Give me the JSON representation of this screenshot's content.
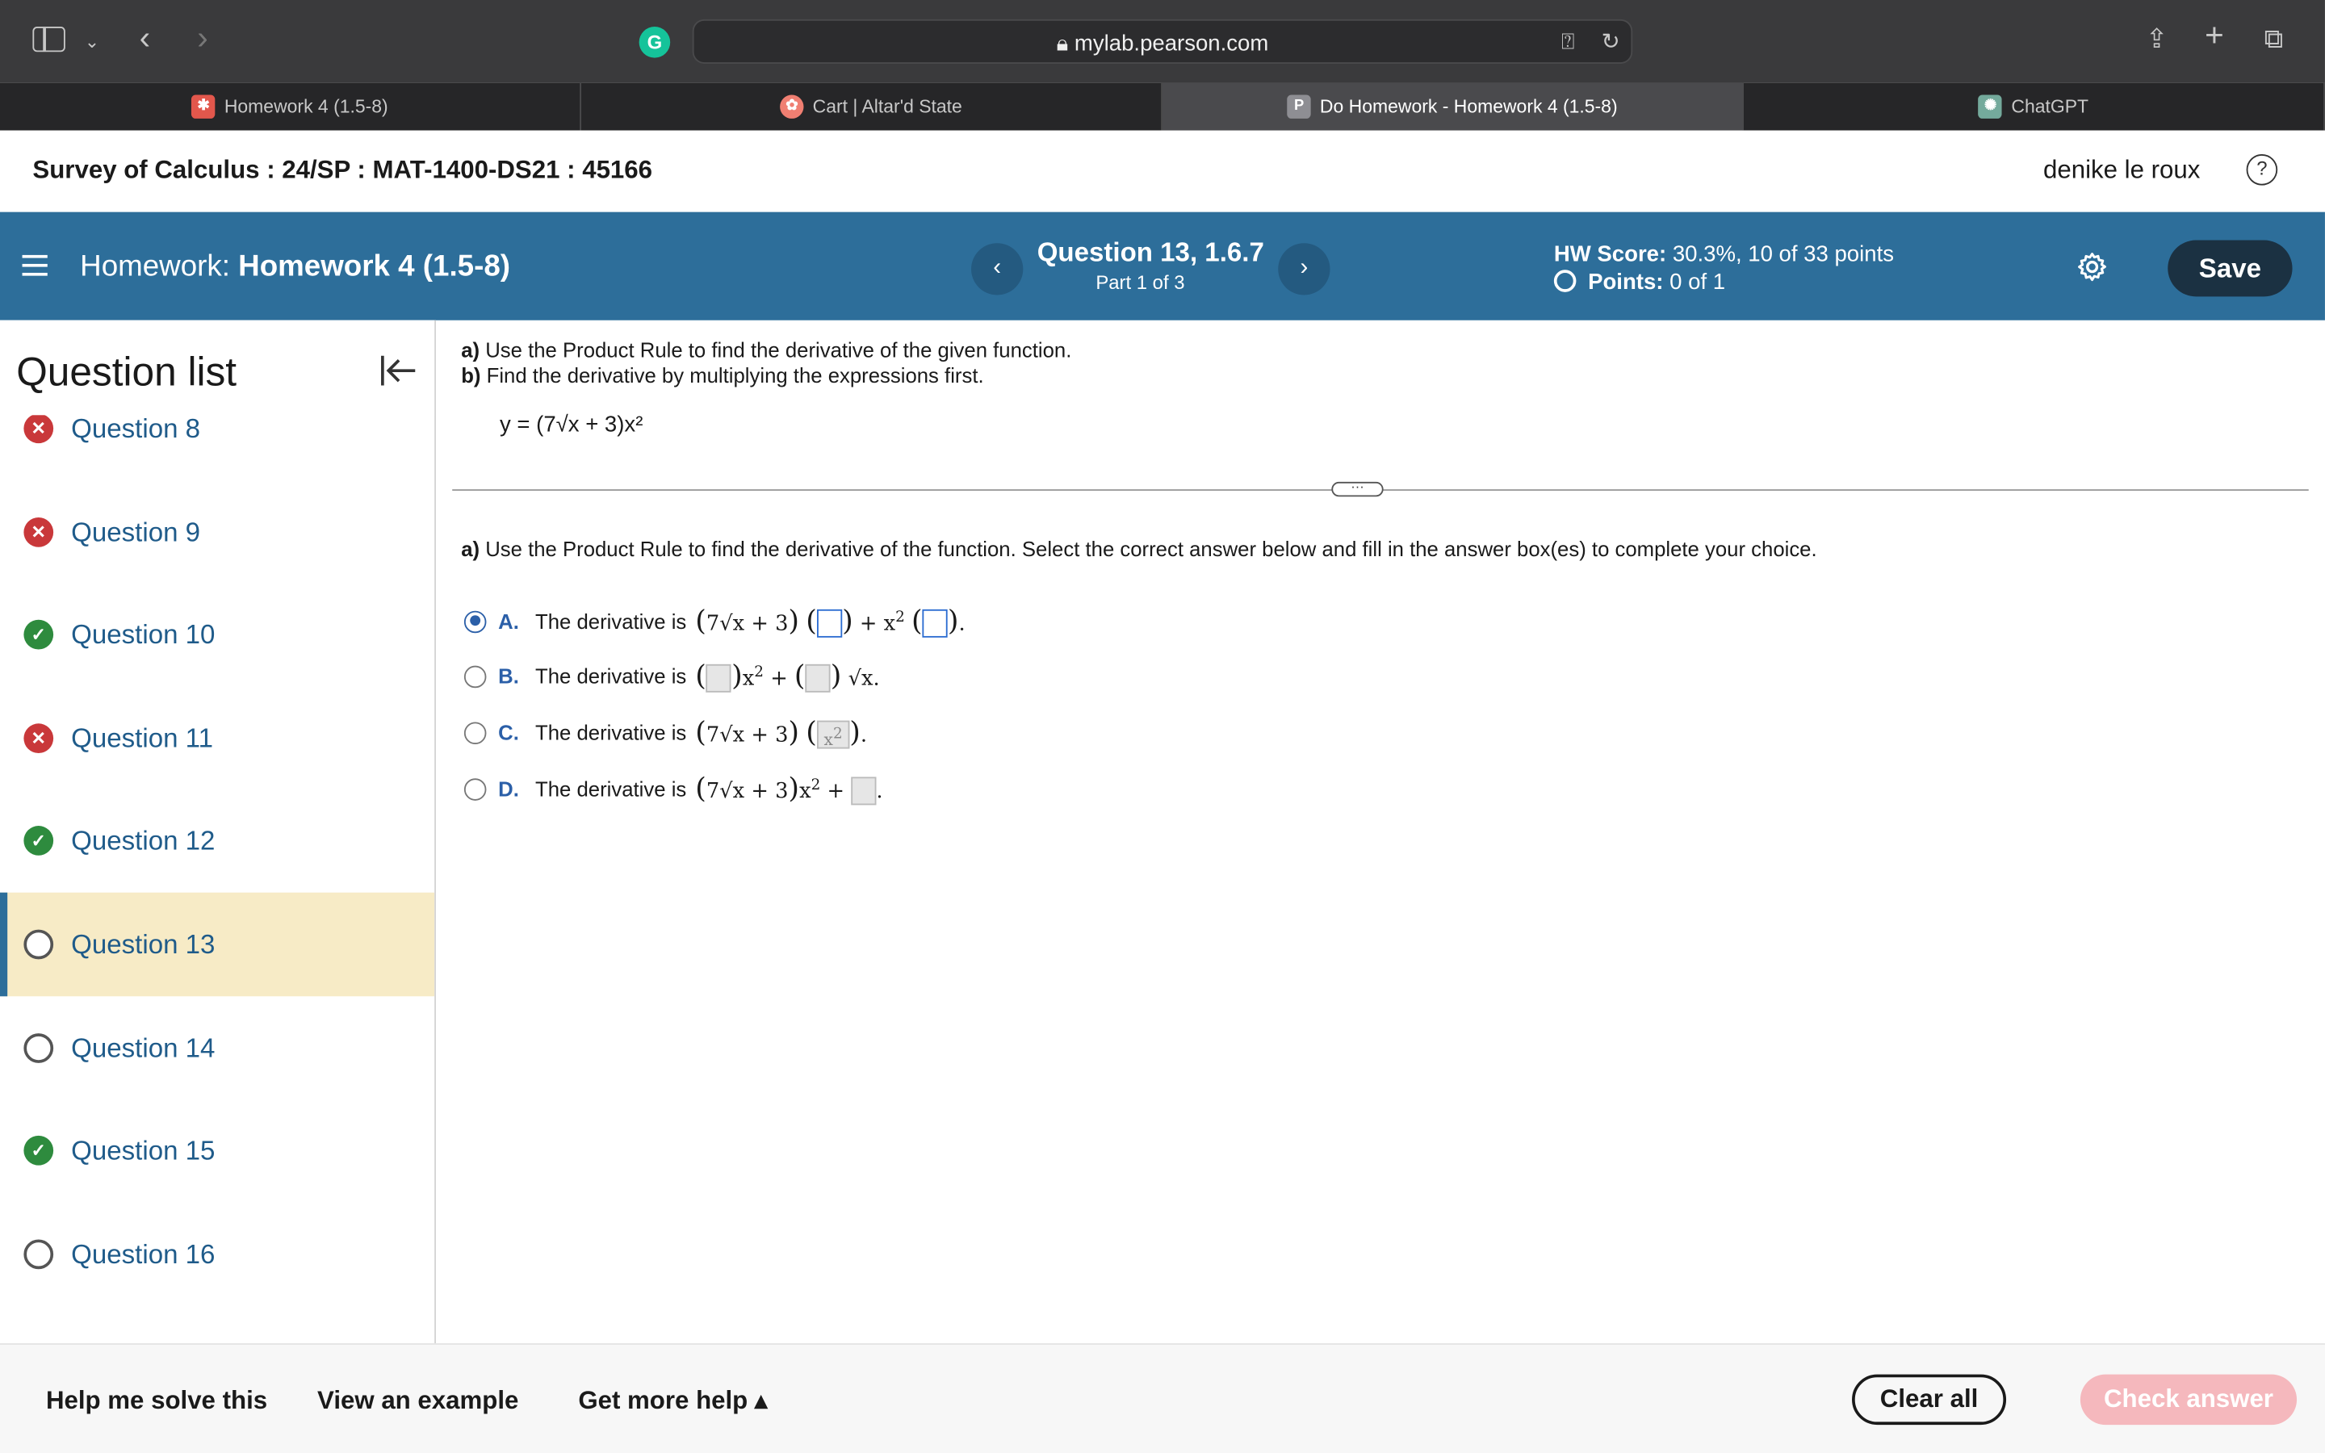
{
  "browser": {
    "url": "mylab.pearson.com",
    "tabs": [
      {
        "label": "Homework 4 (1.5-8)",
        "active": false,
        "favicon_color": "#e2574c"
      },
      {
        "label": "Cart | Altar'd State",
        "active": false,
        "favicon_color": "#f07f72"
      },
      {
        "label": "Do Homework - Homework 4 (1.5-8)",
        "active": true,
        "favicon_color": "#8e8e93"
      },
      {
        "label": "ChatGPT",
        "active": false,
        "favicon_color": "#74aa9c"
      }
    ]
  },
  "course": {
    "title": "Survey of Calculus : 24/SP : MAT-1400-DS21 : 45166",
    "user": "denike le roux",
    "help_icon": "?"
  },
  "homework_bar": {
    "prefix": "Homework:",
    "name": "Homework 4 (1.5-8)",
    "question_title": "Question 13, 1.6.7",
    "part": "Part 1 of 3",
    "score_label": "HW Score:",
    "score_value": "30.3%, 10 of 33 points",
    "points_label": "Points:",
    "points_value": "0 of 1",
    "save_label": "Save",
    "prev_icon": "‹",
    "next_icon": "›",
    "accent_color": "#2d6e9a"
  },
  "question_list": {
    "title": "Question list",
    "items": [
      {
        "label": "Question 8",
        "status": "wrong"
      },
      {
        "label": "Question 9",
        "status": "wrong"
      },
      {
        "label": "Question 10",
        "status": "right"
      },
      {
        "label": "Question 11",
        "status": "wrong"
      },
      {
        "label": "Question 12",
        "status": "right"
      },
      {
        "label": "Question 13",
        "status": "open",
        "current": true
      },
      {
        "label": "Question 14",
        "status": "open"
      },
      {
        "label": "Question 15",
        "status": "right"
      },
      {
        "label": "Question 16",
        "status": "open"
      }
    ]
  },
  "problem": {
    "part_a_label": "a)",
    "part_a_text": "Use the Product Rule to find the derivative of the given function.",
    "part_b_label": "b)",
    "part_b_text": "Find the derivative by multiplying the expressions first.",
    "function": "y = (7√x + 3)x²",
    "prompt_label": "a)",
    "prompt_text": "Use the Product Rule to find the derivative of the function. Select the correct answer below and fill in the answer box(es) to complete your choice.",
    "options": [
      {
        "letter": "A.",
        "text": "The derivative is",
        "selected": true
      },
      {
        "letter": "B.",
        "text": "The derivative is",
        "selected": false
      },
      {
        "letter": "C.",
        "text": "The derivative is",
        "selected": false
      },
      {
        "letter": "D.",
        "text": "The derivative is",
        "selected": false
      }
    ]
  },
  "footer": {
    "help_solve": "Help me solve this",
    "example": "View an example",
    "more_help": "Get more help ▴",
    "clear_all": "Clear all",
    "check_answer": "Check answer"
  }
}
